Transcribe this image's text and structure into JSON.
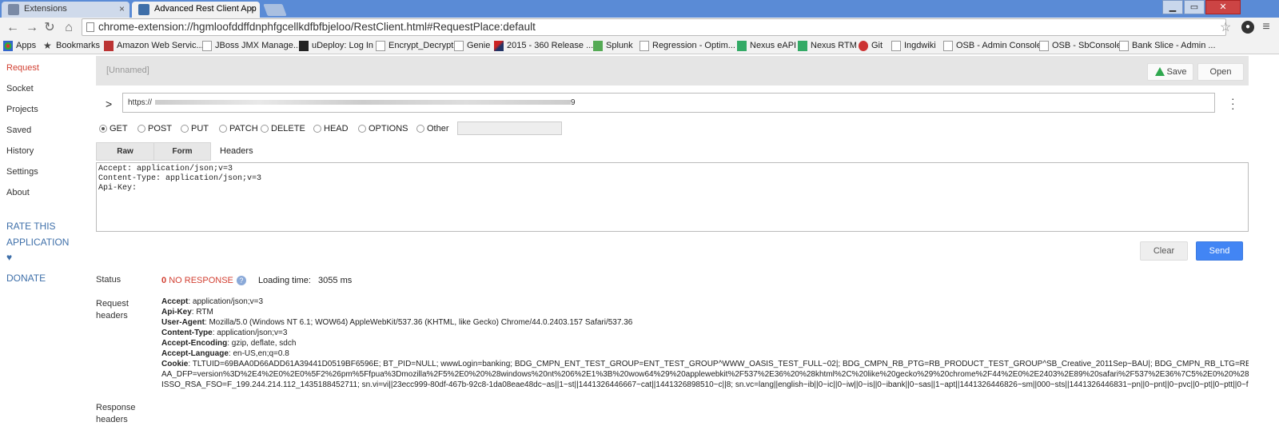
{
  "browser": {
    "tabs": [
      {
        "title": "Extensions",
        "close": "×"
      },
      {
        "title": "Advanced Rest Client App",
        "close": "×"
      }
    ],
    "window_controls": {
      "minimize": "▁",
      "maximize": "▭",
      "close": "✕"
    },
    "url": "chrome-extension://hgmloofddffdnphfgcellkdfbfbjeloo/RestClient.html#RequestPlace:default",
    "bookmarks": [
      {
        "label": "Apps",
        "icon": "apps-grid-icon"
      },
      {
        "label": "Bookmarks",
        "icon": "star-icon"
      },
      {
        "label": "Amazon Web Servic...",
        "icon": "aws-icon"
      },
      {
        "label": "JBoss JMX Manage...",
        "icon": "page-icon"
      },
      {
        "label": "uDeploy: Log In",
        "icon": "udeploy-icon"
      },
      {
        "label": "Encrypt_Decrypt",
        "icon": "page-icon"
      },
      {
        "label": "Genie",
        "icon": "page-icon"
      },
      {
        "label": "2015 - 360 Release ...",
        "icon": "airline-icon"
      },
      {
        "label": "Splunk",
        "icon": "splunk-icon"
      },
      {
        "label": "Regression - Optim...",
        "icon": "page-icon"
      },
      {
        "label": "Nexus eAPI",
        "icon": "nexus-icon"
      },
      {
        "label": "Nexus RTM",
        "icon": "nexus-icon"
      },
      {
        "label": "Git",
        "icon": "git-icon"
      },
      {
        "label": "Ingdwiki",
        "icon": "page-icon"
      },
      {
        "label": "OSB - Admin Console",
        "icon": "page-icon"
      },
      {
        "label": "OSB - SbConsole",
        "icon": "page-icon"
      },
      {
        "label": "Bank Slice - Admin ...",
        "icon": "page-icon"
      }
    ]
  },
  "sidebar": {
    "items": [
      {
        "label": "Request"
      },
      {
        "label": "Socket"
      },
      {
        "label": "Projects"
      },
      {
        "label": "Saved"
      },
      {
        "label": "History"
      },
      {
        "label": "Settings"
      },
      {
        "label": "About"
      }
    ],
    "rate_line1": "RATE THIS",
    "rate_line2": "APPLICATION",
    "heart": "♥",
    "donate": "DONATE"
  },
  "request": {
    "name": "[Unnamed]",
    "save_label": "Save",
    "open_label": "Open",
    "url_prefix": "https://",
    "url_suffix": "9",
    "methods": [
      {
        "label": "GET",
        "checked": true
      },
      {
        "label": "POST",
        "checked": false
      },
      {
        "label": "PUT",
        "checked": false
      },
      {
        "label": "PATCH",
        "checked": false
      },
      {
        "label": "DELETE",
        "checked": false
      },
      {
        "label": "HEAD",
        "checked": false
      },
      {
        "label": "OPTIONS",
        "checked": false
      },
      {
        "label": "Other",
        "checked": false
      }
    ],
    "tabs": {
      "raw": "Raw",
      "form": "Form",
      "headers": "Headers"
    },
    "headers_text": "Accept: application/json;v=3\nContent-Type: application/json;v=3\nApi-Key: ",
    "clear_label": "Clear",
    "send_label": "Send"
  },
  "response": {
    "status_label": "Status",
    "status_code": "0",
    "status_text": "NO RESPONSE",
    "loading_label": "Loading time:",
    "loading_value": "3055 ms",
    "request_headers_label_1": "Request",
    "request_headers_label_2": "headers",
    "response_headers_label_1": "Response",
    "response_headers_label_2": "headers",
    "request_headers": [
      {
        "name": "Accept",
        "value": ": application/json;v=3"
      },
      {
        "name": "Api-Key",
        "value": ": RTM"
      },
      {
        "name": "User-Agent",
        "value": ": Mozilla/5.0 (Windows NT 6.1; WOW64) AppleWebKit/537.36 (KHTML, like Gecko) Chrome/44.0.2403.157 Safari/537.36"
      },
      {
        "name": "Content-Type",
        "value": ": application/json;v=3"
      },
      {
        "name": "Accept-Encoding",
        "value": ": gzip, deflate, sdch"
      },
      {
        "name": "Accept-Language",
        "value": ": en-US,en;q=0.8"
      },
      {
        "name": "Cookie",
        "value": ": TLTUID=69BAA0D66ADD61A39441D0519BF6596E; BT_PID=NULL; wwwLogin=banking; BDG_CMPN_ENT_TEST_GROUP=ENT_TEST_GROUP^WWW_OASIS_TEST_FULL~02|; BDG_CMPN_RB_PTG=RB_PRODUCT_TEST_GROUP^SB_Creative_2011Sep~BAU|; BDG_CMPN_RB_LTG=RB_LAYOU"
      }
    ],
    "cookie_line2": "AA_DFP=version%3D%2E4%2E0%2E0%5F2%26pm%5Ffpua%3Dmozilla%2F5%2E0%20%28windows%20nt%206%2E1%3B%20wow64%29%20applewebkit%2F537%2E36%20%28khtml%2C%20like%20gecko%29%20chrome%2F44%2E0%2E2403%2E89%20safari%2F537%2E36%7C5%2E0%20%28Windo",
    "cookie_line3": "ISSO_RSA_FSO=F_199.244.214.112_1435188452711; sn.vi=vi||23ecc999-80df-467b-92c8-1da08eae48dc~as||1~st||1441326446667~cat||1441326898510~c||8; sn.vc=lang||english~ib||0~ic||0~iw||0~is||0~ibank||0~sas||1~apt||1441326446826~sm||000~sts||1441326446831~pn||0~pnt||0~pvc||0~pt||0~ptt||0~fun||0~p"
  }
}
